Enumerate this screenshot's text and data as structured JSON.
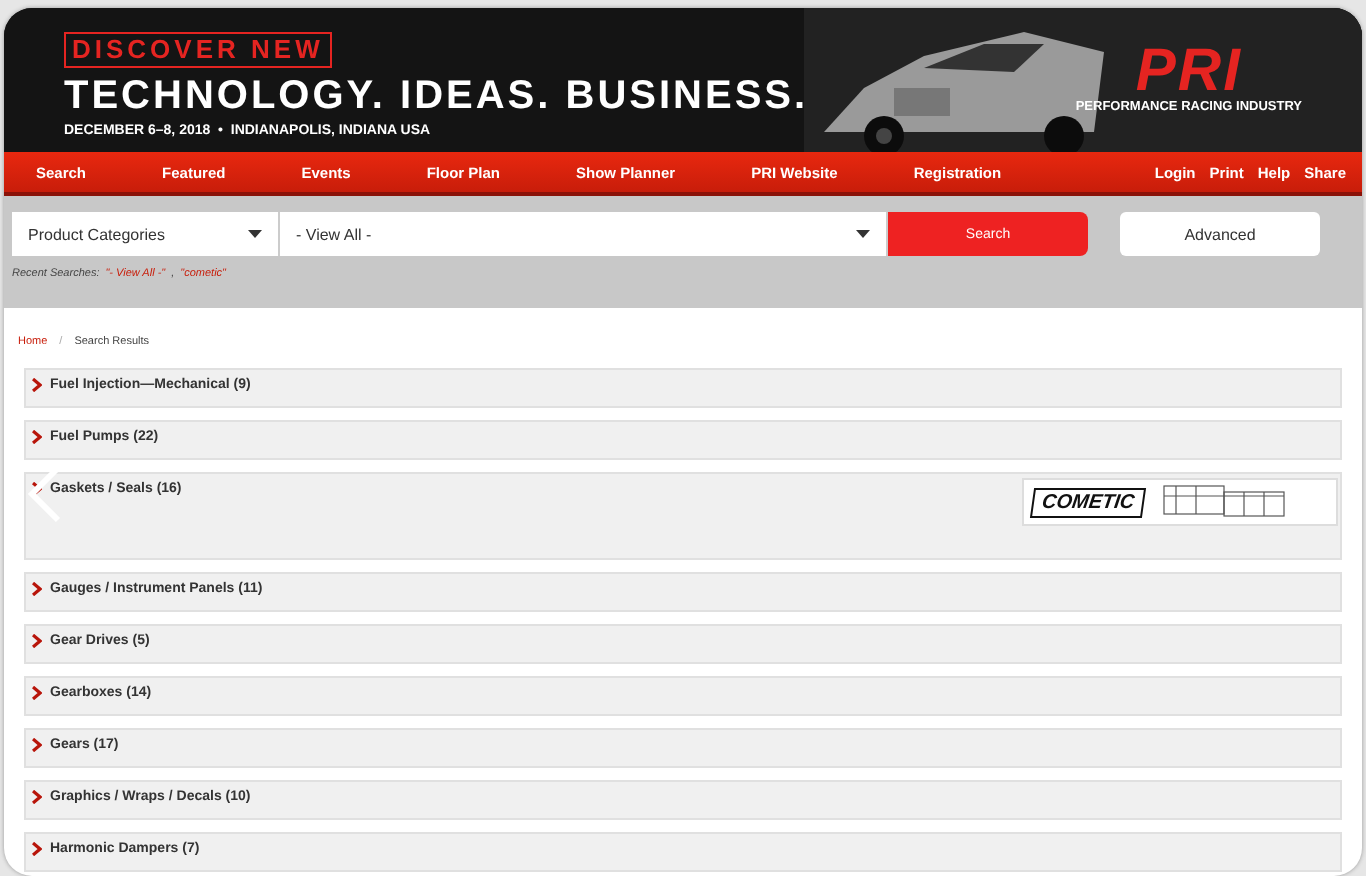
{
  "banner": {
    "tagline": "DISCOVER NEW",
    "headline": "TECHNOLOGY. IDEAS. BUSINESS.",
    "details": "DECEMBER 6–8, 2018  •  INDIANAPOLIS, INDIANA USA",
    "logo": "PRI",
    "logo_caption": "PERFORMANCE RACING INDUSTRY"
  },
  "nav": {
    "items": [
      "Search",
      "Featured",
      "Events",
      "Floor Plan",
      "Show Planner",
      "PRI Website",
      "Registration"
    ],
    "utility": [
      "Login",
      "Print",
      "Help",
      "Share"
    ]
  },
  "search": {
    "category": "Product Categories",
    "value": "- View All -",
    "button": "Search",
    "advanced": "Advanced",
    "recent_label": "Recent Searches:",
    "recent": [
      "\"- View All -\"",
      "\"cometic\""
    ],
    "recent_separator": ","
  },
  "breadcrumb": [
    "Home",
    "Search Results"
  ],
  "breadcrumb_separator": "/",
  "categories": [
    {
      "label": "Fuel Injection—Mechanical (9)"
    },
    {
      "label": "Fuel Pumps (22)"
    },
    {
      "label": "Gaskets / Seals (16)",
      "ad": "COMETIC"
    },
    {
      "label": "Gauges / Instrument Panels (11)"
    },
    {
      "label": "Gear Drives (5)"
    },
    {
      "label": "Gearboxes (14)"
    },
    {
      "label": "Gears (17)"
    },
    {
      "label": "Graphics / Wraps / Decals (10)"
    },
    {
      "label": "Harmonic Dampers (7)"
    }
  ]
}
